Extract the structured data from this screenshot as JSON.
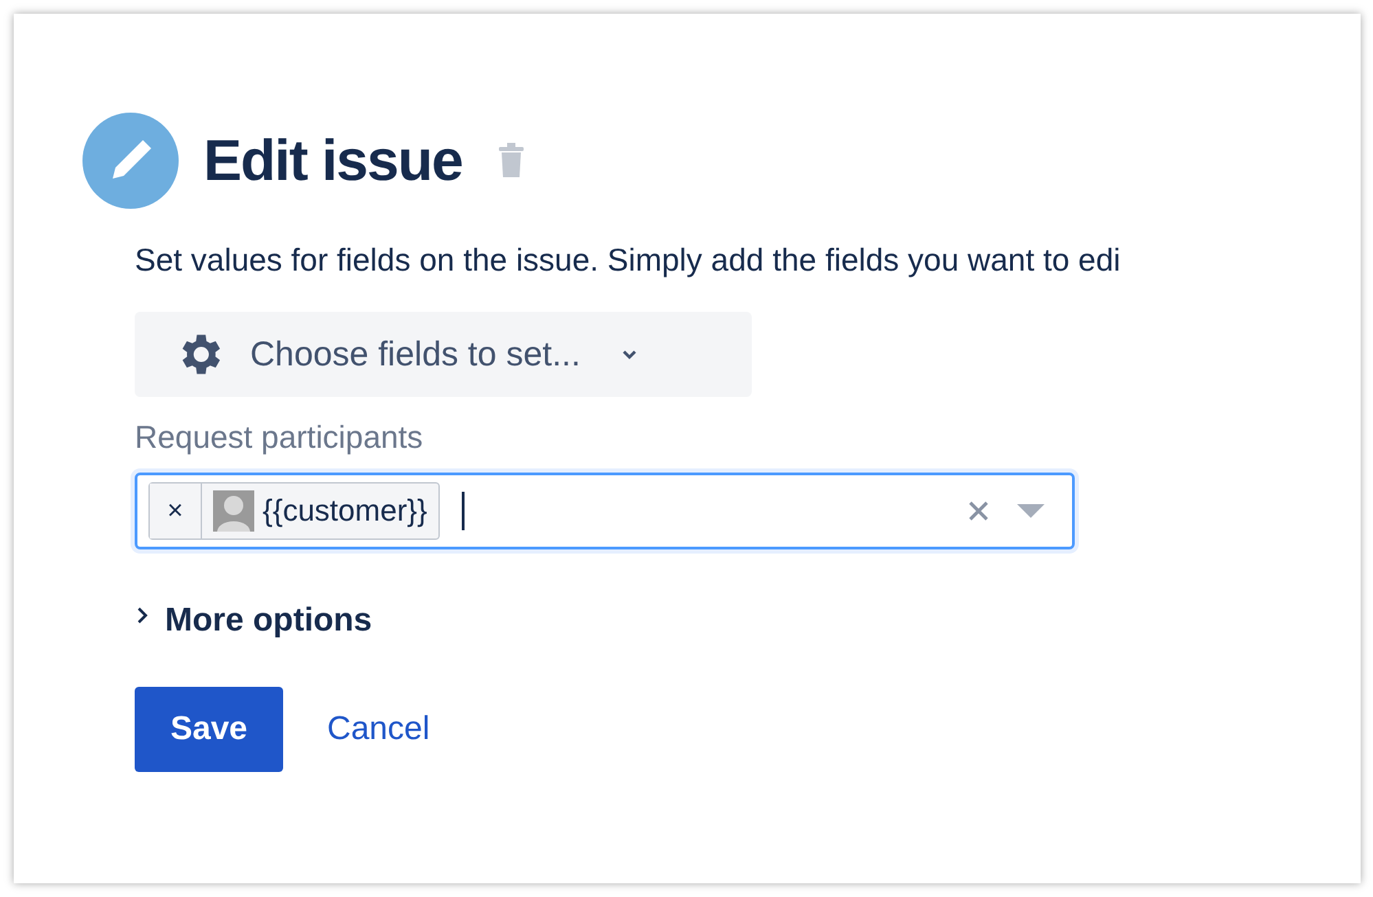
{
  "title": "Edit issue",
  "description": "Set values for fields on the issue. Simply add the fields you want to edi",
  "field_chooser": {
    "label": "Choose fields to set..."
  },
  "participants": {
    "label": "Request participants",
    "tokens": [
      {
        "remove": "×",
        "name": "{{customer}}"
      }
    ]
  },
  "more_options": {
    "label": "More options",
    "expanded": false
  },
  "buttons": [
    {
      "kind": "primary",
      "label": "Save"
    },
    {
      "kind": "link",
      "label": "Cancel"
    }
  ]
}
